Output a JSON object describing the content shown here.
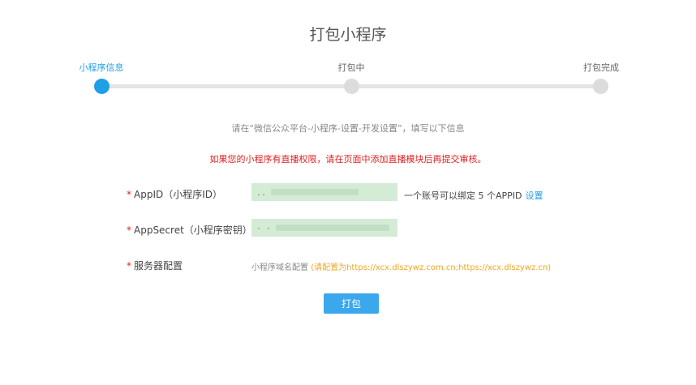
{
  "page": {
    "title": "打包小程序"
  },
  "steps": [
    {
      "label": "小程序信息",
      "active": true
    },
    {
      "label": "打包中",
      "active": false
    },
    {
      "label": "打包完成",
      "active": false
    }
  ],
  "hint": "请在“微信公众平台-小程序-设置-开发设置”，填写以下信息",
  "warning": "如果您的小程序有直播权限，请在页面中添加直播模块后再提交审核。",
  "form": {
    "required_mark": "*",
    "appid": {
      "label": "AppID（小程序ID）",
      "value": "..",
      "note": "一个账号可以绑定 5 个APPID",
      "link": "设置"
    },
    "appsecret": {
      "label": "AppSecret（小程序密钥）",
      "value": "· ·"
    },
    "server": {
      "label": "服务器配置",
      "note_prefix": "小程序域名配置",
      "note_highlight": "(请配置为https://xcx.dlszywz.com.cn;https://xcx.dlszywz.cn)"
    }
  },
  "actions": {
    "pack_label": "打包"
  },
  "colors": {
    "accent": "#1e9fe6",
    "warning": "#e02020",
    "field_bg": "#d4ecd6",
    "highlight": "#f5a623"
  }
}
